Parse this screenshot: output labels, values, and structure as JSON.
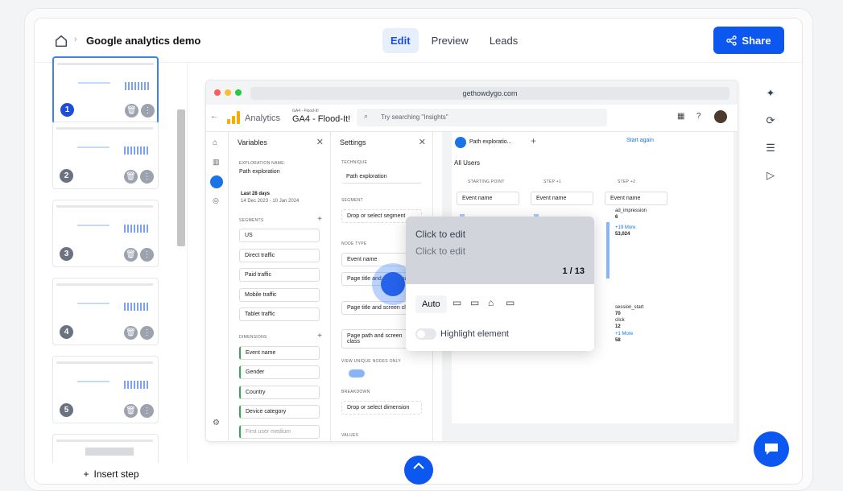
{
  "header": {
    "title": "Google analytics demo",
    "tabs": [
      "Edit",
      "Preview",
      "Leads"
    ],
    "share_label": "Share"
  },
  "sidebar": {
    "steps": [
      "1",
      "2",
      "3",
      "4",
      "5"
    ],
    "insert_label": "Insert step"
  },
  "browser": {
    "url": "gethowdygo.com"
  },
  "ga": {
    "product": "Analytics",
    "property_small": "GA4 - Flood-It!",
    "property": "GA4 - Flood-It!",
    "search_placeholder": "Try searching \"Insights\"",
    "variables": {
      "title": "Variables",
      "exploration_caption": "EXPLORATION NAME:",
      "exploration_name": "Path exploration",
      "date_label": "Last 28 days",
      "date_range": "14 Dec 2023 - 10 Jan 2024",
      "segments_caption": "SEGMENTS",
      "segments": [
        "US",
        "Direct traffic",
        "Paid traffic",
        "Mobile traffic",
        "Tablet traffic"
      ],
      "dimensions_caption": "DIMENSIONS",
      "dimensions": [
        "Event name",
        "Gender",
        "Country",
        "Device category",
        "First user medium"
      ]
    },
    "settings": {
      "title": "Settings",
      "technique_caption": "TECHNIQUE",
      "technique": "Path exploration",
      "segment_caption": "SEGMENT",
      "segment_drop": "Drop or select segment",
      "node_caption": "NODE TYPE",
      "nodes": [
        "Event name",
        "Page title and screen name",
        "Page title and screen class",
        "Page path and screen class"
      ],
      "unique_caption": "VIEW UNIQUE NODES ONLY",
      "breakdown_caption": "BREAKDOWN",
      "breakdown_drop": "Drop or select dimension",
      "values_caption": "VALUES"
    },
    "canvas": {
      "tab": "Path exploratio...",
      "start_again": "Start again",
      "segment": "All Users",
      "cols": [
        "STARTING POINT",
        "STEP +1",
        "STEP +2"
      ],
      "node_label": "Event name",
      "right_items": [
        {
          "name": "ad_impression",
          "value": "6"
        },
        {
          "name": "+19 More",
          "value": "53,024"
        },
        {
          "name": "session_start",
          "value": "70"
        },
        {
          "name": "click",
          "value": "12"
        },
        {
          "name": "+1 More",
          "value": "58"
        }
      ]
    }
  },
  "popup": {
    "title": "Click to edit",
    "body": "Click to edit",
    "counter": "1 / 13",
    "auto_label": "Auto",
    "highlight_label": "Highlight element"
  }
}
